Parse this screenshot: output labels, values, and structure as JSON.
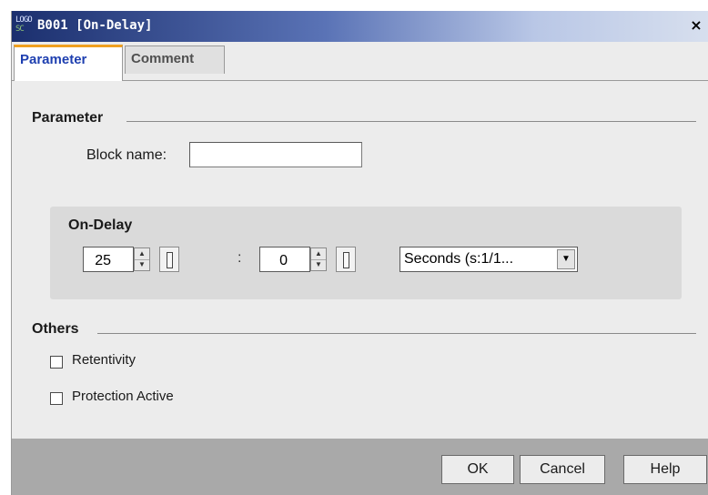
{
  "window": {
    "logo_line1": "LOGO",
    "logo_line2": "SC",
    "title": "B001 [On-Delay]",
    "close_glyph": "×"
  },
  "tabs": [
    {
      "label": "Parameter",
      "active": true
    },
    {
      "label": "Comment",
      "active": false
    }
  ],
  "parameter_group": {
    "header": "Parameter",
    "block_name_label": "Block name:",
    "block_name_value": ""
  },
  "on_delay": {
    "header": "On-Delay",
    "value1": "25",
    "separator": ":",
    "value2": "0",
    "unit_selected": "Seconds (s:1/1..."
  },
  "others_group": {
    "header": "Others",
    "retentivity_label": "Retentivity",
    "retentivity_checked": false,
    "protection_label": "Protection Active",
    "protection_checked": false
  },
  "footer": {
    "ok_label": "OK",
    "cancel_label": "Cancel",
    "help_label": "Help"
  },
  "colors": {
    "title_gradient_start": "#1b2f6e",
    "title_gradient_end": "#d7dfee",
    "active_tab_text": "#1e3fb0",
    "active_tab_accent": "#f0a020",
    "dialog_bg": "#ececec",
    "footer_bg": "#a9a9a9"
  },
  "icons": {
    "spin_up": "▲",
    "spin_down": "▼",
    "dropdown": "▼"
  }
}
